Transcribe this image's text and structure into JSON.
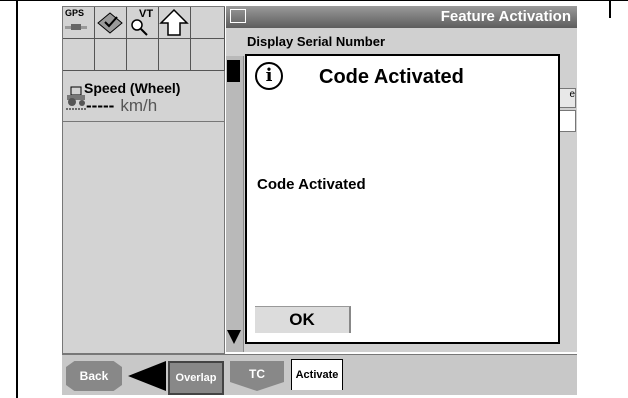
{
  "window": {
    "title": "Feature Activation"
  },
  "header": {
    "serial_label": "Display Serial Number"
  },
  "left_panel": {
    "gps_label": "GPS",
    "vt_label": "VT",
    "speed_label": "Speed (Wheel)",
    "speed_value": "-----",
    "speed_unit": "km/h"
  },
  "dialog": {
    "title": "Code Activated",
    "message": "Code Activated",
    "ok_label": "OK"
  },
  "side_fragment": "e",
  "bottom_bar": {
    "back_label": "Back",
    "overlap_label": "Overlap",
    "tc_label": "TC",
    "activate_tab": "Activate"
  },
  "colors": {
    "panel_bg": "#d3d3d3",
    "titlebar": "#6e6e6e",
    "dialog_bg": "#ffffff"
  }
}
